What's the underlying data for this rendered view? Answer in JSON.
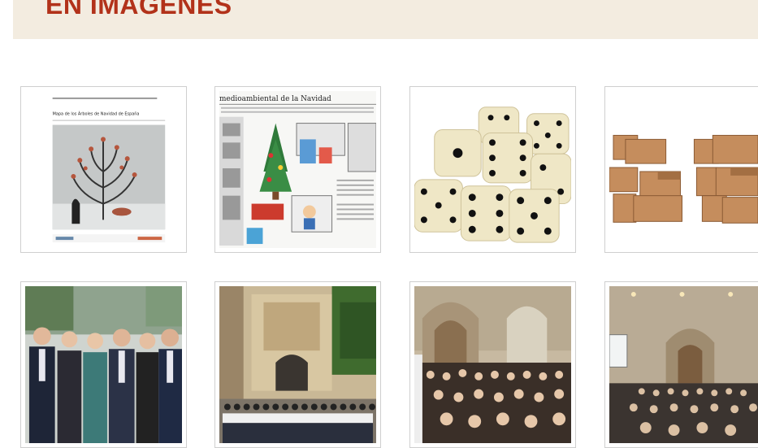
{
  "section": {
    "title": "EN IMÁGENES"
  },
  "gallery": {
    "items": [
      {
        "name": "poster-tree",
        "caption_line": "Mapa de los Árboles de Navidad de España"
      },
      {
        "name": "newspaper-infographic",
        "caption_line": "medioambiental de la Navidad"
      },
      {
        "name": "dice-pile"
      },
      {
        "name": "wooden-puzzle"
      },
      {
        "name": "group-photo-suits"
      },
      {
        "name": "group-photo-facade"
      },
      {
        "name": "conference-audience"
      },
      {
        "name": "conference-hall"
      }
    ]
  },
  "colors": {
    "title": "#b2321a",
    "banner_bg": "#f3ece0",
    "thumb_border": "#cfcfcf"
  }
}
